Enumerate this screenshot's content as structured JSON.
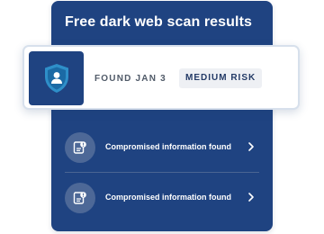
{
  "scan_panel": {
    "title": "Free dark web scan results"
  },
  "result": {
    "icon": "shield-user-icon",
    "found_label": "FOUND JAN 3",
    "risk_label": "MEDIUM RISK"
  },
  "findings": [
    {
      "icon": "id-card-alert-icon",
      "label": "Compromised information found"
    },
    {
      "icon": "id-card-alert-icon",
      "label": "Compromised information found"
    }
  ],
  "colors": {
    "panel_background": "#1f4381",
    "card_background": "#ffffff",
    "badge_background": "#eef0f4",
    "badge_text": "#233a66",
    "shield_fill": "#2e8fc9"
  }
}
